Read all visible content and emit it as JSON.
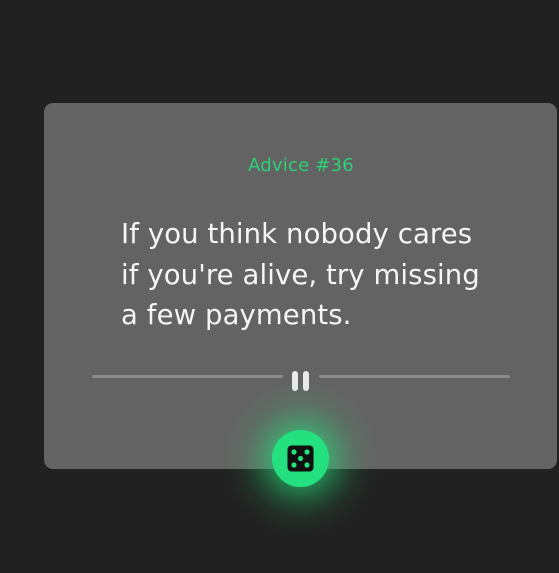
{
  "card": {
    "advice_label": "Advice #36",
    "advice_text": "If you think nobody cares if you're alive, try missing a few payments."
  },
  "controls": {
    "divider_icon": "pause-icon",
    "dice_icon": "dice-icon"
  },
  "colors": {
    "background": "#212121",
    "card": "#636363",
    "accent": "#25e07e",
    "label": "#2bd177",
    "text": "#f5f5f5"
  }
}
